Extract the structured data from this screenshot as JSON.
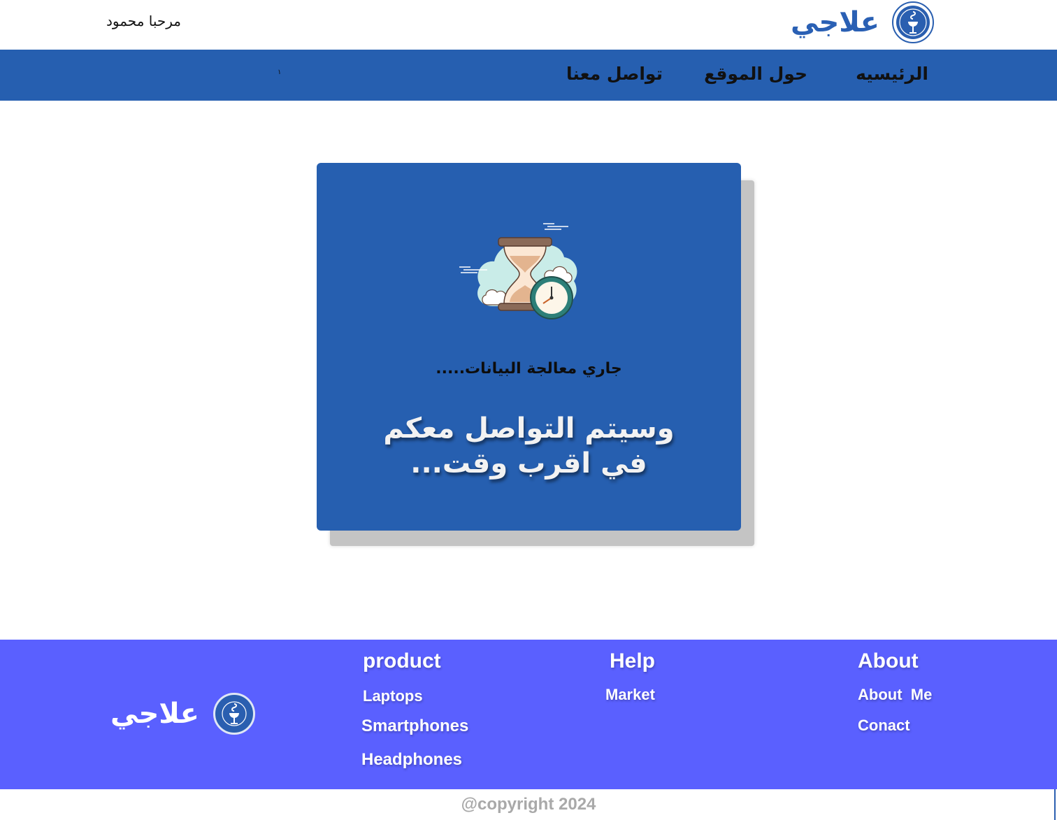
{
  "header": {
    "greeting": "مرحبا محمود",
    "brand_name": "علاجي",
    "logo_icon": "pharmacy-bowl-snake-icon"
  },
  "nav": {
    "items": [
      {
        "label": "الرئيسيه"
      },
      {
        "label": "حول الموقع"
      },
      {
        "label": "تواصل معنا"
      }
    ],
    "badge": "١",
    "background": "#265fb0"
  },
  "card": {
    "illustration_icon": "hourglass-clock-cloud-icon",
    "processing_text": "جاري معالجة البيانات.....",
    "message": "وسيتم التواصل معكم في اقرب وقت...",
    "background": "#265fb0"
  },
  "footer": {
    "brand_name": "علاجي",
    "background": "#5a60ff",
    "columns": [
      {
        "title": "product",
        "links": [
          "Laptops",
          "Smartphones",
          "Headphones"
        ]
      },
      {
        "title": "Help",
        "links": [
          "Market"
        ]
      },
      {
        "title": "About",
        "links": [
          "About  Me",
          "Conact"
        ]
      }
    ]
  },
  "copyright": "@copyright 2024"
}
